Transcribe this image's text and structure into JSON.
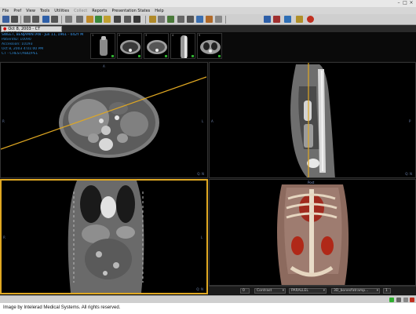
{
  "menu": [
    "File",
    "Pref",
    "View",
    "Tools",
    "Utilities",
    "Collect",
    "Reports",
    "Presentation States",
    "Help"
  ],
  "menu_disabled": [
    false,
    false,
    false,
    false,
    false,
    true,
    false,
    false,
    false
  ],
  "study_tab": {
    "label": "Oct 8, 2003 - CT CHEST/AB..."
  },
  "patient": {
    "name": "SWEET, BENJAMIN IAN - Jun 11, 1961 - 042Y M",
    "id": "PatientID: 10090",
    "accession": "Accession: 10193",
    "date": "Oct 8, 2003 4:01:00 PM",
    "study": "CT - CHEST/ABD/PEL"
  },
  "thumbnails": [
    {
      "num": "1",
      "kind": "scout"
    },
    {
      "num": "2",
      "kind": "axial"
    },
    {
      "num": "3",
      "kind": "axial"
    },
    {
      "num": "4",
      "kind": "sagittal"
    },
    {
      "num": "5",
      "kind": "axial"
    }
  ],
  "viewports": {
    "axial": {
      "top_label": "A",
      "left_label": "R",
      "right_label": "L",
      "corner": "Q: N"
    },
    "sagittal": {
      "top_label": "S",
      "left_label": "A",
      "right_label": "P",
      "corner": "Q: N"
    },
    "coronal": {
      "top_label": "S",
      "left_label": "R",
      "right_label": "L",
      "corner": "Q: N"
    },
    "volume": {
      "top_label": "Post",
      "corner": "Q: N"
    }
  },
  "vr_controls": {
    "value": "0",
    "mode": "Contrast",
    "projection": "PARALLEL",
    "preset": "3D_bonesfatramp...",
    "extra": "1"
  },
  "credit": "Image by Intelerad Medical Systems. All rights reserved.",
  "colors": {
    "accent": "#e0a822",
    "patient_text": "#2f8bd6",
    "crosshair": "#e0a822"
  }
}
